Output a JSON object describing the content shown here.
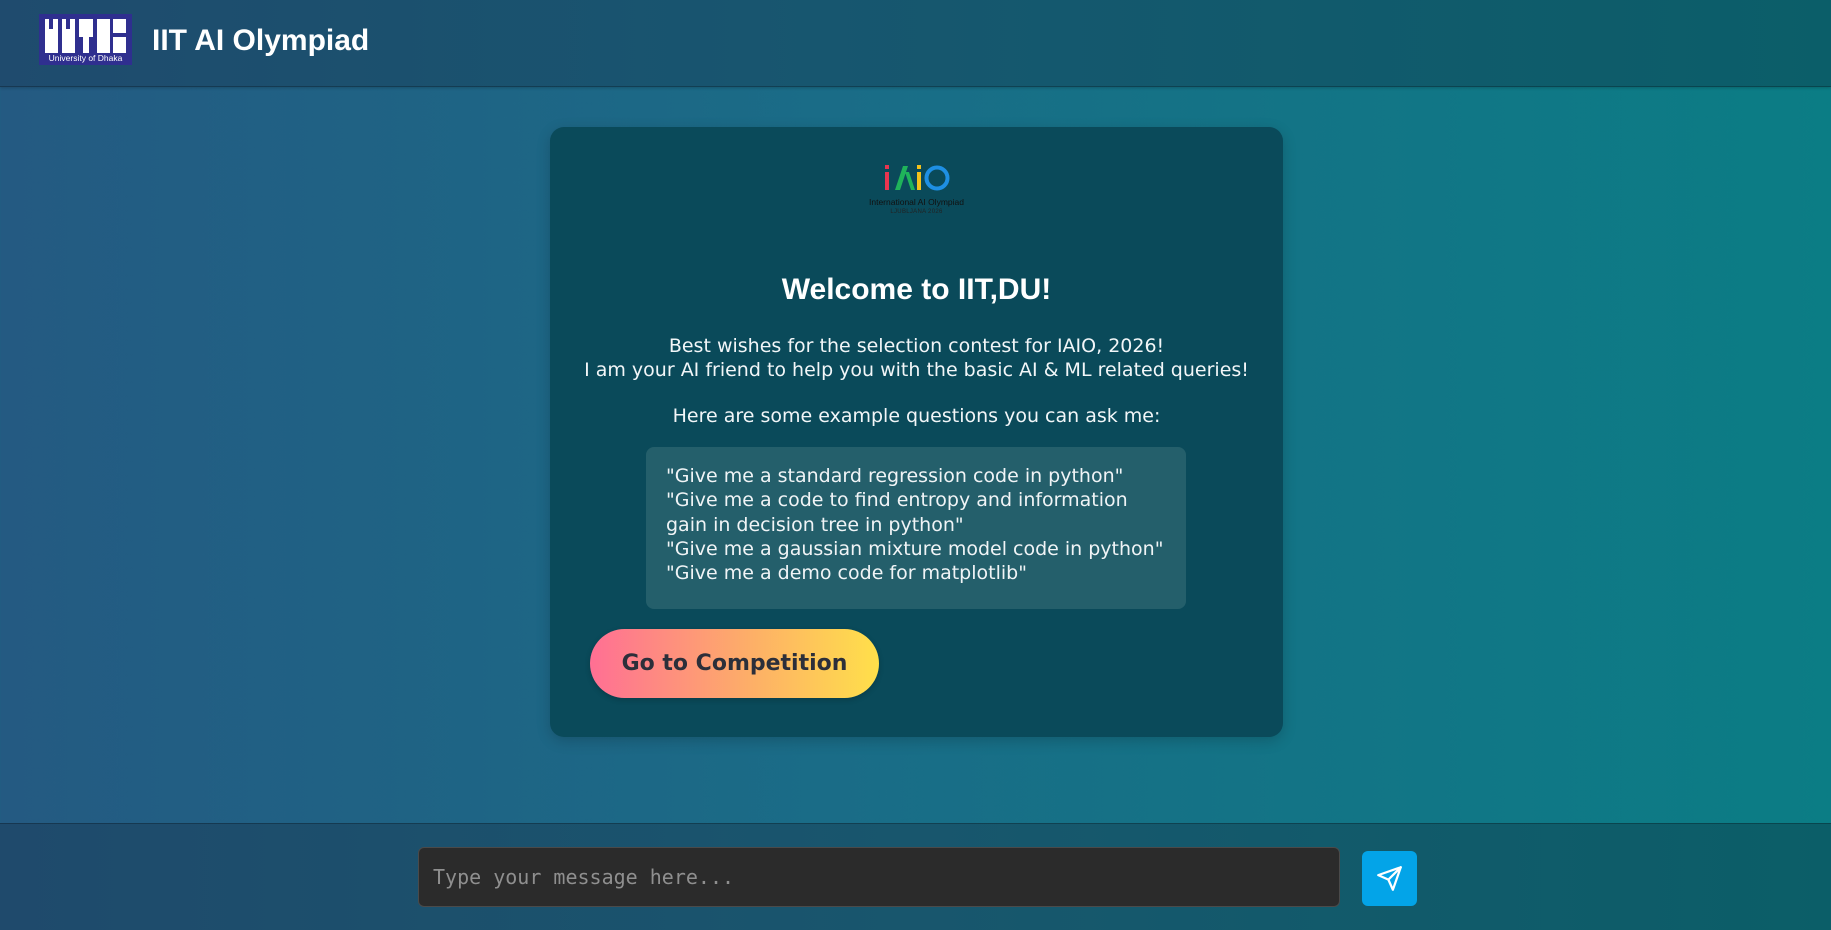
{
  "header": {
    "logo": {
      "text": "IIT",
      "subtitle": "University of Dhaka"
    },
    "title": "IIT AI Olympiad"
  },
  "card": {
    "badge": {
      "wordmark": "iAiO",
      "subtitle": "International AI Olympiad",
      "tagline": "LJUBLJANA 2026",
      "colors": [
        "#e8354f",
        "#1fb35a",
        "#f4c21a",
        "#1e8fe3"
      ]
    },
    "welcome": "Welcome to IIT,DU!",
    "intro_lines": [
      "Best wishes for the selection contest for IAIO, 2026!",
      "I am your AI friend to help you with the basic AI & ML related queries!"
    ],
    "examples_title": "Here are some example questions you can ask me:",
    "examples": [
      "\"Give me a standard regression code in python\"",
      "\"Give me a code to find entropy and information gain in decision tree in python\"",
      "\"Give me a gaussian mixture model code in python\"",
      "\"Give me a demo code for matplotlib\""
    ],
    "cta_label": "Go to Competition"
  },
  "composer": {
    "placeholder": "Type your message here...",
    "value": "",
    "send_icon": "send-icon"
  },
  "colors": {
    "accent_send": "#03a4e8",
    "card_bg": "#0a4a5a",
    "cta_gradient": [
      "#ff6f94",
      "#ffe04a"
    ]
  }
}
